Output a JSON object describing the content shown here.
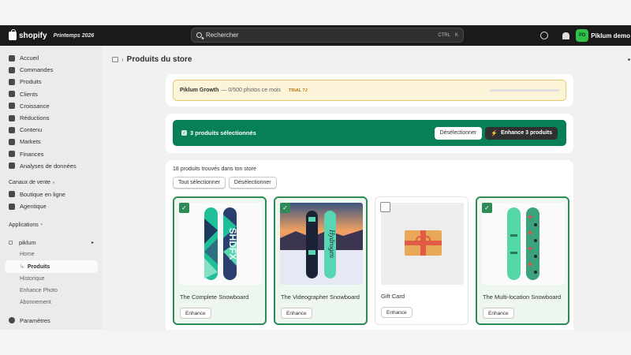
{
  "topbar": {
    "brand": "shopify",
    "edition": "Printemps 2026",
    "search_placeholder": "Rechercher",
    "shortcut_ctrl": "CTRL",
    "shortcut_k": "K",
    "avatar_initials": "PD",
    "user_name": "Piklum demo"
  },
  "sidebar": {
    "items": [
      {
        "label": "Accueil",
        "icon": "home-icon"
      },
      {
        "label": "Commandes",
        "icon": "orders-icon"
      },
      {
        "label": "Produits",
        "icon": "tag-icon"
      },
      {
        "label": "Clients",
        "icon": "person-icon"
      },
      {
        "label": "Croissance",
        "icon": "target-icon"
      },
      {
        "label": "Réductions",
        "icon": "discount-icon"
      },
      {
        "label": "Contenu",
        "icon": "content-icon"
      },
      {
        "label": "Markets",
        "icon": "globe-icon"
      },
      {
        "label": "Finances",
        "icon": "bank-icon"
      },
      {
        "label": "Analyses de données",
        "icon": "chart-icon"
      }
    ],
    "channels_title": "Canaux de vente",
    "channels": [
      {
        "label": "Boutique en ligne",
        "icon": "store-icon"
      },
      {
        "label": "Agentique",
        "icon": "agent-icon"
      }
    ],
    "apps_title": "Applications",
    "app_name": "piklum",
    "app_items": [
      {
        "label": "Home",
        "active": false
      },
      {
        "label": "Produits",
        "active": true
      },
      {
        "label": "Historique",
        "active": false
      },
      {
        "label": "Enhance Photo",
        "active": false
      },
      {
        "label": "Abonnement",
        "active": false
      }
    ],
    "settings_label": "Paramètres"
  },
  "page": {
    "title": "Produits du store"
  },
  "trial": {
    "plan": "Piklum Growth",
    "usage": "— 0/500 photos ce mois",
    "badge": "TRIAL 7J",
    "progress": 0.0
  },
  "selection": {
    "text": "3 produits sélectionnés",
    "deselect_label": "Désélectionner",
    "enhance_label": "Enhance 3 produits"
  },
  "products_section": {
    "found_text": "18 produits trouvés dans ton store",
    "select_all_label": "Tout sélectionner",
    "deselect_label": "Désélectionner",
    "enhance_label": "Enhance",
    "products": [
      {
        "title": "The Complete Snowboard",
        "selected": true
      },
      {
        "title": "The Videographer Snowboard",
        "selected": true
      },
      {
        "title": "Gift Card",
        "selected": false
      },
      {
        "title": "The Multi-location Snowboard",
        "selected": true
      }
    ]
  },
  "colors": {
    "accent_green": "#07805a",
    "selected_border": "#2e8b57",
    "trial_bg": "#fcf4d8"
  }
}
